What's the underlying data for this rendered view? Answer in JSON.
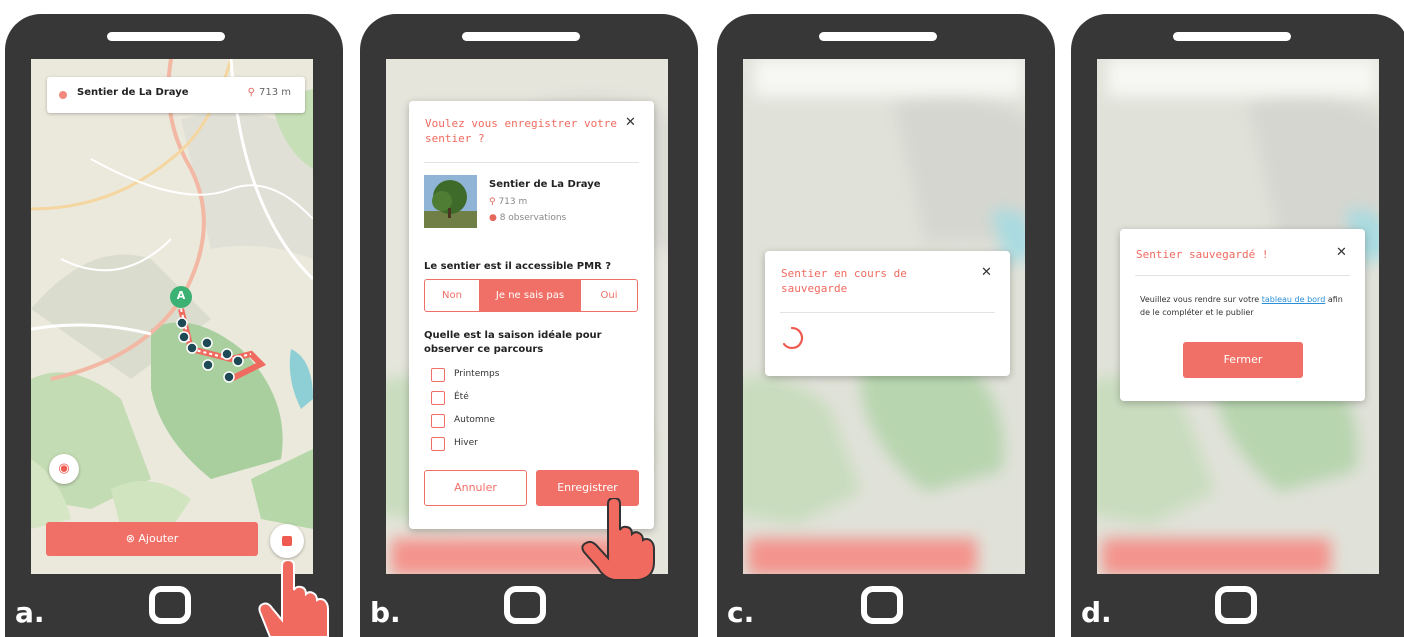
{
  "panels": [
    {
      "caption": "a."
    },
    {
      "caption": "b."
    },
    {
      "caption": "c."
    },
    {
      "caption": "d."
    }
  ],
  "trail": {
    "name": "Sentier de La Draye",
    "distance": "713 m",
    "observations": "8 observations"
  },
  "map": {
    "marker_label": "A",
    "add_button": "Ajouter"
  },
  "save_dialog": {
    "title": "Voulez vous enregistrer votre sentier ?",
    "pmr_question": "Le sentier est il accessible PMR ?",
    "pmr_options": [
      "Non",
      "Je ne sais pas",
      "Oui"
    ],
    "pmr_selected": "Je ne sais pas",
    "season_question": "Quelle est la saison idéale pour observer ce parcours",
    "seasons": [
      "Printemps",
      "Été",
      "Automne",
      "Hiver"
    ],
    "cancel": "Annuler",
    "save": "Enregistrer"
  },
  "saving_dialog": {
    "title": "Sentier en cours de sauvegarde"
  },
  "saved_dialog": {
    "title": "Sentier sauvegardé !",
    "text_before": "Veuillez vous rendre sur votre ",
    "link": "tableau de bord",
    "text_after": " afin de le compléter et le publier",
    "close": "Fermer"
  },
  "colors": {
    "accent": "#f07067",
    "phone": "#373737",
    "route": "#1e4a55"
  }
}
